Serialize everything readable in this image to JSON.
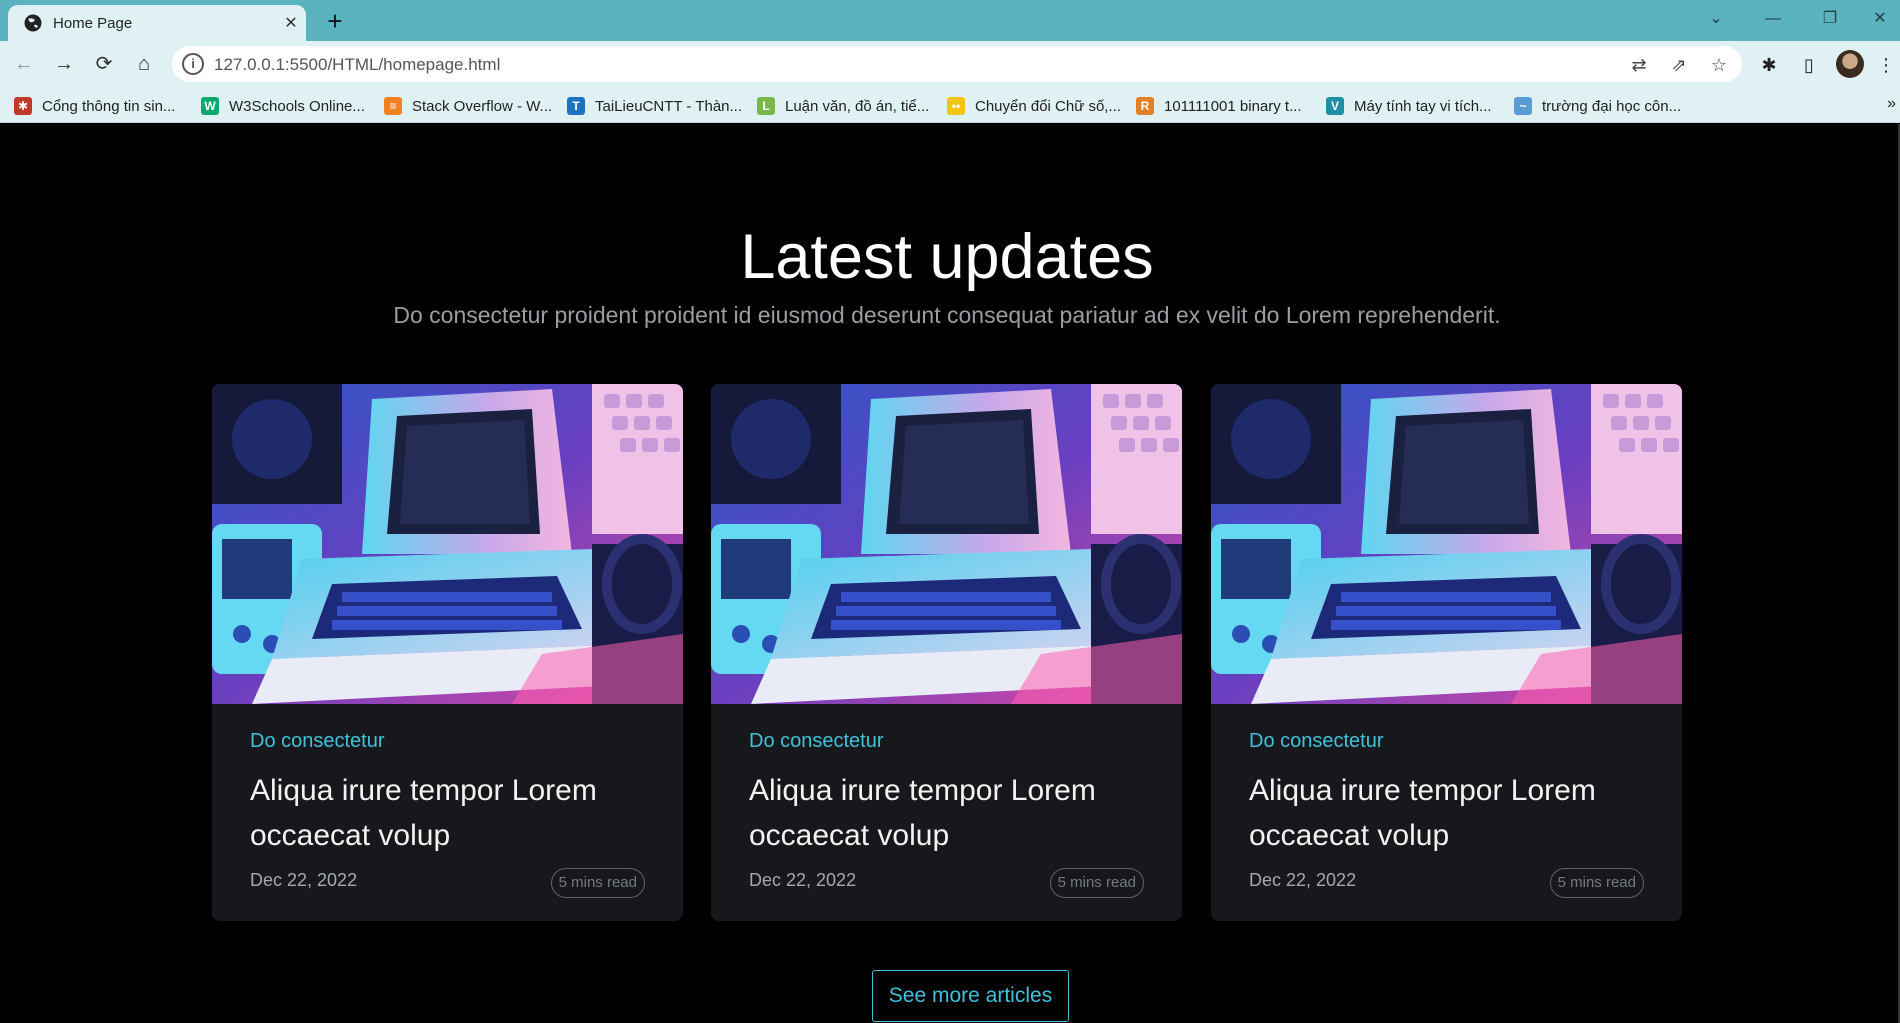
{
  "browser": {
    "tab_title": "Home Page",
    "tab_close": "✕",
    "new_tab": "+",
    "url": "127.0.0.1:5500/HTML/homepage.html",
    "window_controls": {
      "chevron": "⌄",
      "minimize": "—",
      "restore": "❐",
      "close": "✕"
    },
    "nav": {
      "back": "←",
      "forward": "→",
      "reload": "⟳",
      "home": "⌂"
    },
    "toolbar_icons": {
      "translate": "⇄",
      "share": "⇗",
      "star": "☆",
      "extensions": "✱",
      "sidebar": "▯",
      "menu": "⋮"
    },
    "bookmarks": [
      {
        "label": "Cổng thông tin sin...",
        "fav_color": "#c0392b",
        "fav_char": "✱"
      },
      {
        "label": "W3Schools Online...",
        "fav_color": "#04aa6d",
        "fav_char": "W"
      },
      {
        "label": "Stack Overflow - W...",
        "fav_color": "#f48024",
        "fav_char": "≡"
      },
      {
        "label": "TaiLieuCNTT - Thàn...",
        "fav_color": "#1e73be",
        "fav_char": "T"
      },
      {
        "label": "Luận văn, đồ án, tiể...",
        "fav_color": "#7ab648",
        "fav_char": "L"
      },
      {
        "label": "Chuyển đổi Chữ số,...",
        "fav_color": "#f1c40f",
        "fav_char": "••"
      },
      {
        "label": "101111001 binary t...",
        "fav_color": "#e67e22",
        "fav_char": "R"
      },
      {
        "label": "Máy tính tay vi tích...",
        "fav_color": "#1f8fa6",
        "fav_char": "V"
      },
      {
        "label": "trường đại học côn...",
        "fav_color": "#5b9bd5",
        "fav_char": "~"
      }
    ],
    "bookmarks_more": "»"
  },
  "section": {
    "title": "Latest updates",
    "subtitle": "Do consectetur proident proident id eiusmod deserunt consequat pariatur ad ex velit do Lorem reprehenderit."
  },
  "cards": [
    {
      "category": "Do consectetur",
      "title": "Aliqua irure tempor Lorem occaecat volup",
      "date": "Dec 22, 2022",
      "read_time": "5 mins read"
    },
    {
      "category": "Do consectetur",
      "title": "Aliqua irure tempor Lorem occaecat volup",
      "date": "Dec 22, 2022",
      "read_time": "5 mins read"
    },
    {
      "category": "Do consectetur",
      "title": "Aliqua irure tempor Lorem occaecat volup",
      "date": "Dec 22, 2022",
      "read_time": "5 mins read"
    }
  ],
  "cta": {
    "label": "See more articles"
  },
  "colors": {
    "accent": "#3fc2da",
    "card_bg": "#16181c",
    "page_bg": "#000000",
    "chrome": "#5ab3bf"
  }
}
